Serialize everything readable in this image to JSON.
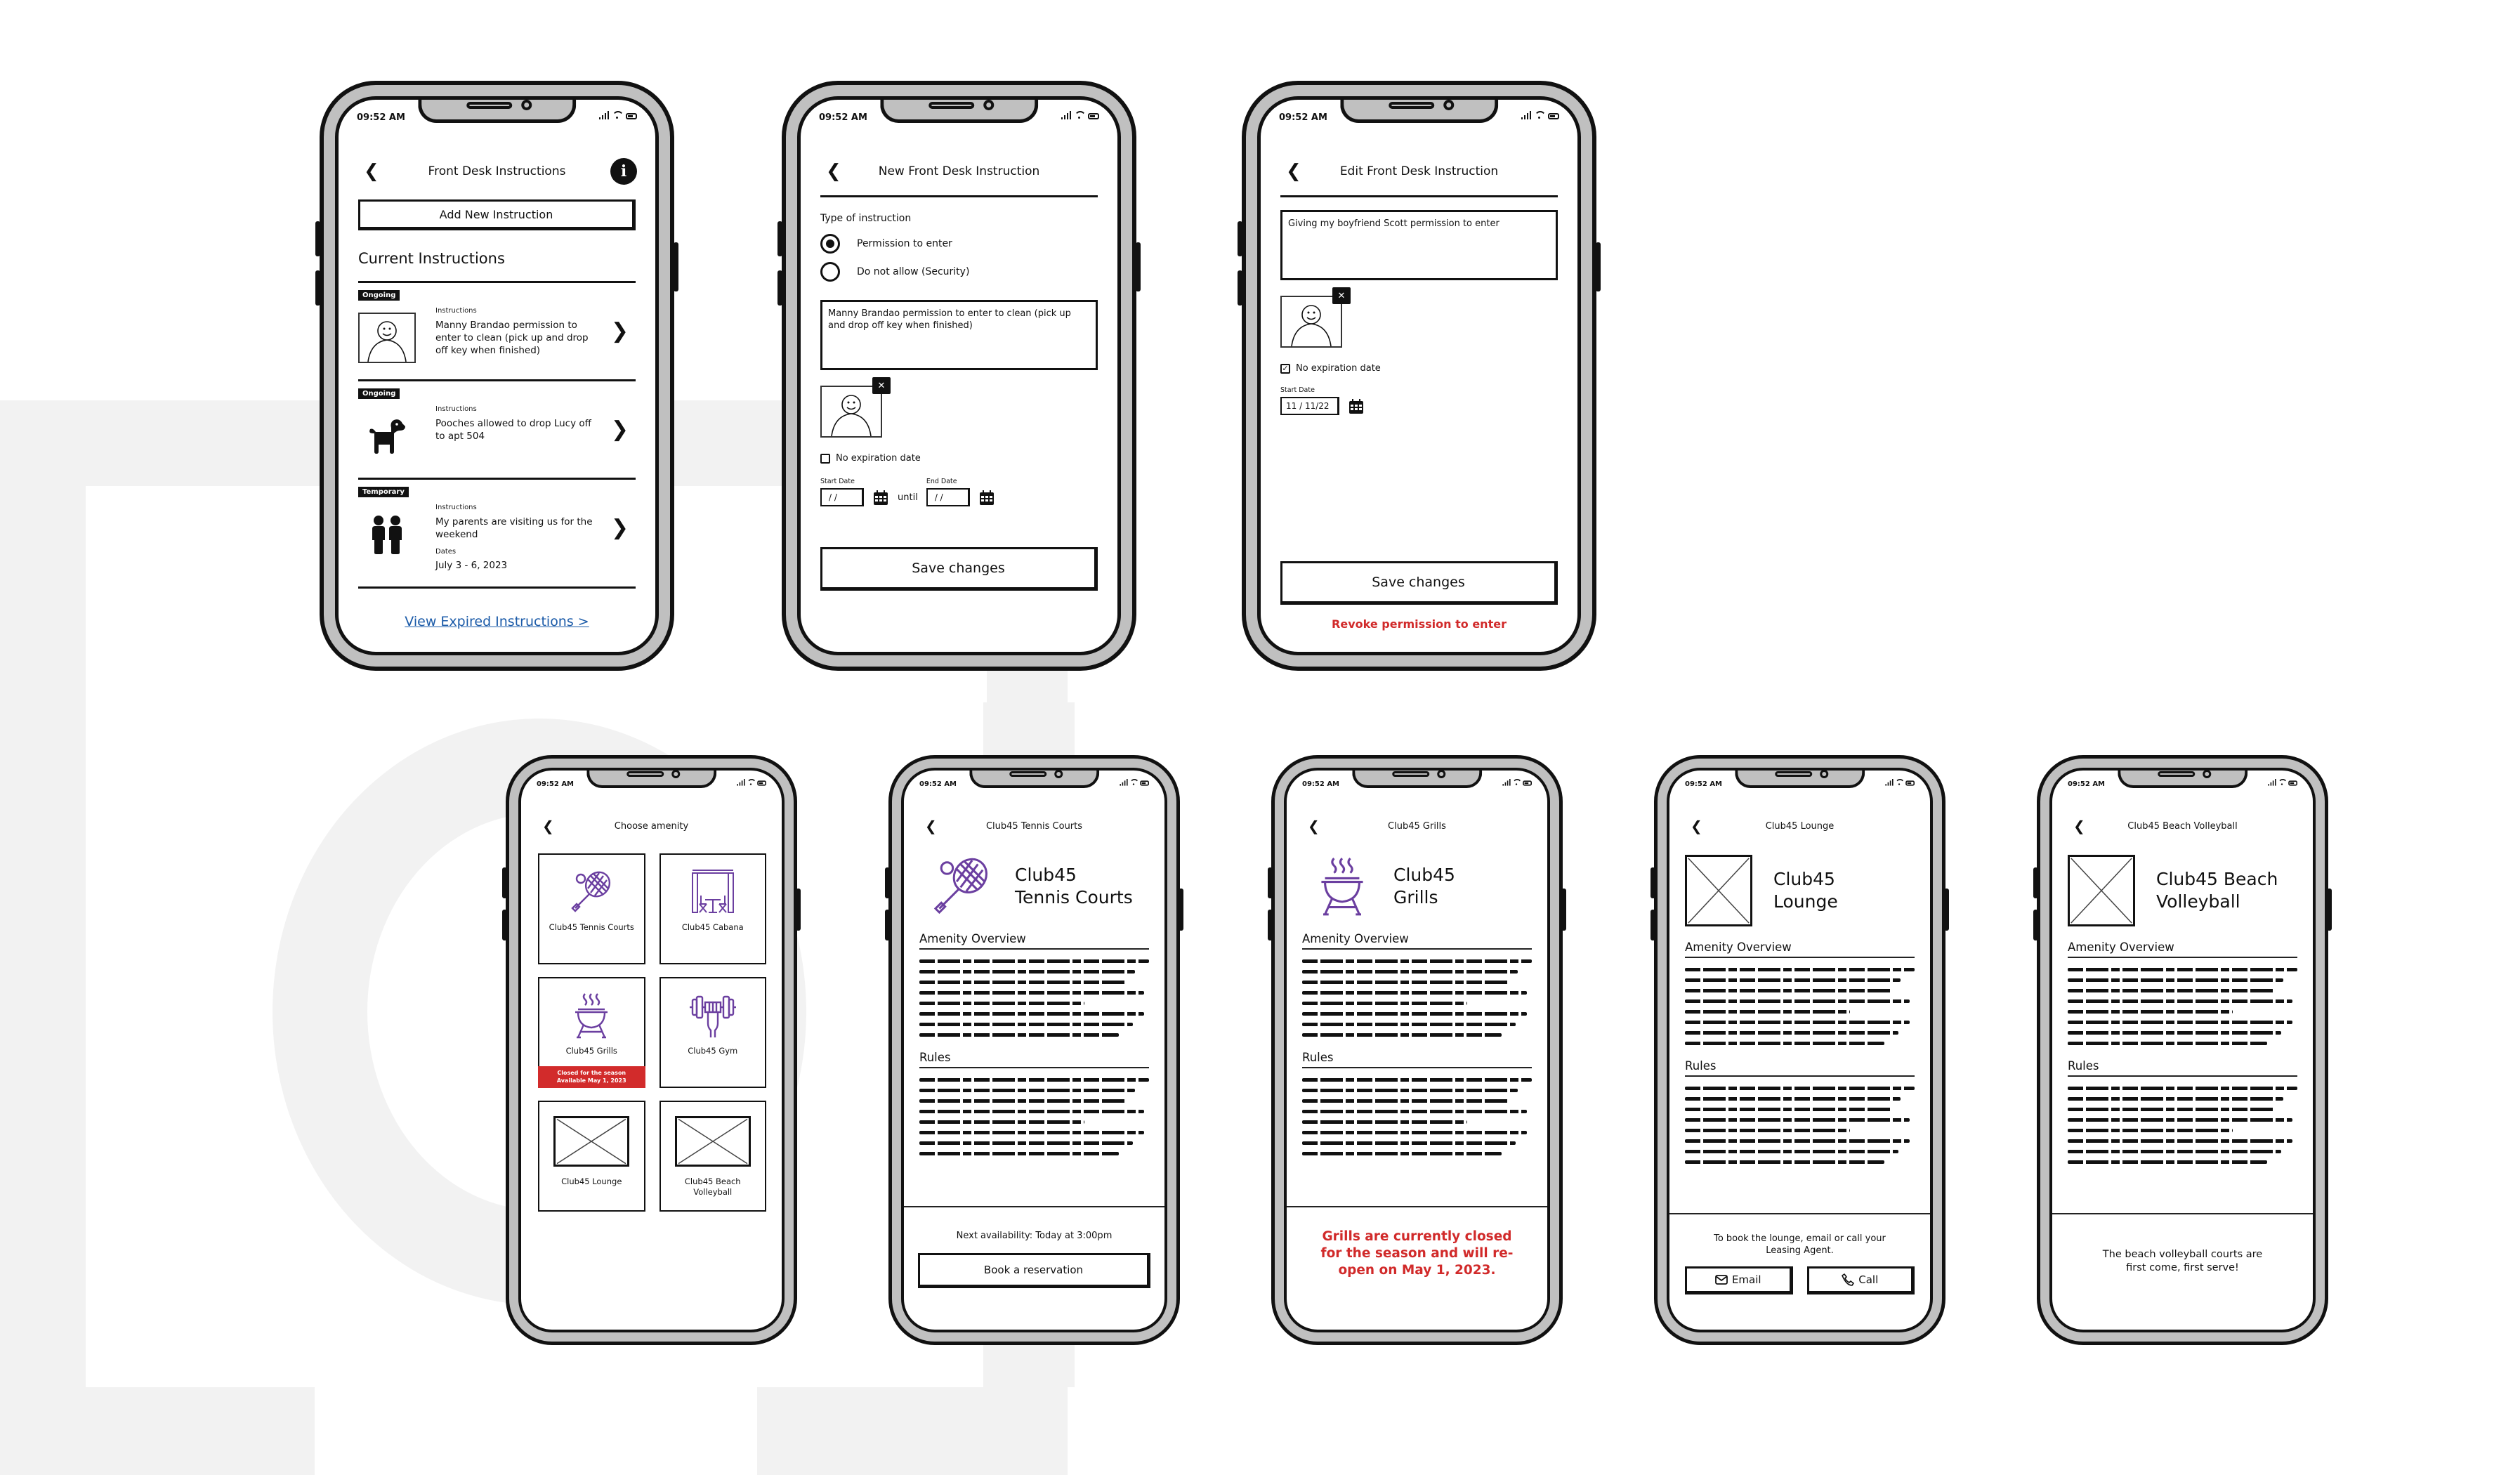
{
  "status_bar": {
    "time": "09:52 AM"
  },
  "colors": {
    "accent_purple": "#6b3fa0",
    "alert_red": "#d12a2a",
    "link_blue": "#1a5aa8",
    "frame_grey": "#c0c0c0"
  },
  "screens": {
    "front_desk": {
      "title": "Front Desk Instructions",
      "info_icon": "info-icon",
      "add_button": "Add New Instruction",
      "section_title": "Current Instructions",
      "items": [
        {
          "badge": "Ongoing",
          "label": "Instructions",
          "text": "Manny Brandao permission to enter to clean (pick up and drop off key when finished)",
          "icon": "person-photo-icon"
        },
        {
          "badge": "Ongoing",
          "label": "Instructions",
          "text": "Pooches allowed to drop Lucy off to apt 504",
          "icon": "dog-icon"
        },
        {
          "badge": "Temporary",
          "label": "Instructions",
          "text": "My parents are visiting us for the weekend",
          "dates_label": "Dates",
          "dates": "July 3 - 6, 2023",
          "icon": "people-icon"
        }
      ],
      "expired_link": "View Expired Instructions >"
    },
    "new_instruction": {
      "title": "New Front Desk Instruction",
      "type_label": "Type of instruction",
      "options": [
        {
          "label": "Permission to enter",
          "selected": true
        },
        {
          "label": "Do not allow (Security)",
          "selected": false
        }
      ],
      "textarea_value": "Manny Brandao permission to enter to clean (pick up and drop off key when finished)",
      "remove_photo": "✕",
      "no_expiration_label": "No expiration date",
      "no_expiration_checked": false,
      "start_date_label": "Start Date",
      "start_date_value": "/ /",
      "until_label": "until",
      "end_date_label": "End Date",
      "end_date_value": "/ /",
      "save_button": "Save changes"
    },
    "edit_instruction": {
      "title": "Edit Front Desk Instruction",
      "textarea_value": "Giving my boyfriend Scott permission to enter",
      "remove_photo": "✕",
      "no_expiration_label": "No expiration date",
      "no_expiration_checked": true,
      "start_date_label": "Start Date",
      "start_date_value": "11 / 11/22",
      "save_button": "Save changes",
      "revoke_link": "Revoke permission to enter"
    },
    "choose_amenity": {
      "title": "Choose amenity",
      "tiles": [
        {
          "label": "Club45 Tennis Courts",
          "icon": "tennis-racket-icon"
        },
        {
          "label": "Club45 Cabana",
          "icon": "cabana-icon"
        },
        {
          "label": "Club45 Grills",
          "icon": "grill-icon",
          "closed_line1": "Closed for the season",
          "closed_line2": "Available May 1, 2023"
        },
        {
          "label": "Club45 Gym",
          "icon": "dumbbell-icon"
        },
        {
          "label": "Club45 Lounge",
          "icon": "image-placeholder-icon"
        },
        {
          "label": "Club45 Beach Volleyball",
          "icon": "image-placeholder-icon"
        }
      ]
    },
    "tennis": {
      "title": "Club45 Tennis Courts",
      "hero_line1": "Club45",
      "hero_line2": "Tennis Courts",
      "overview_title": "Amenity Overview",
      "rules_title": "Rules",
      "availability": "Next availability: Today at 3:00pm",
      "book_button": "Book a reservation"
    },
    "grills": {
      "title": "Club45 Grills",
      "hero_line1": "Club45",
      "hero_line2": "Grills",
      "overview_title": "Amenity Overview",
      "rules_title": "Rules",
      "closed_message": "Grills are currently closed for the season and will re-open on May 1, 2023."
    },
    "lounge": {
      "title": "Club45 Lounge",
      "hero_line1": "Club45",
      "hero_line2": "Lounge",
      "overview_title": "Amenity Overview",
      "rules_title": "Rules",
      "booking_note": "To book the lounge, email or call your Leasing Agent.",
      "email_button": "Email",
      "call_button": "Call"
    },
    "volleyball": {
      "title": "Club45 Beach Volleyball",
      "hero_line1": "Club45 Beach",
      "hero_line2": "Volleyball",
      "overview_title": "Amenity Overview",
      "rules_title": "Rules",
      "note": "The beach volleyball courts are first come, first serve!"
    }
  }
}
